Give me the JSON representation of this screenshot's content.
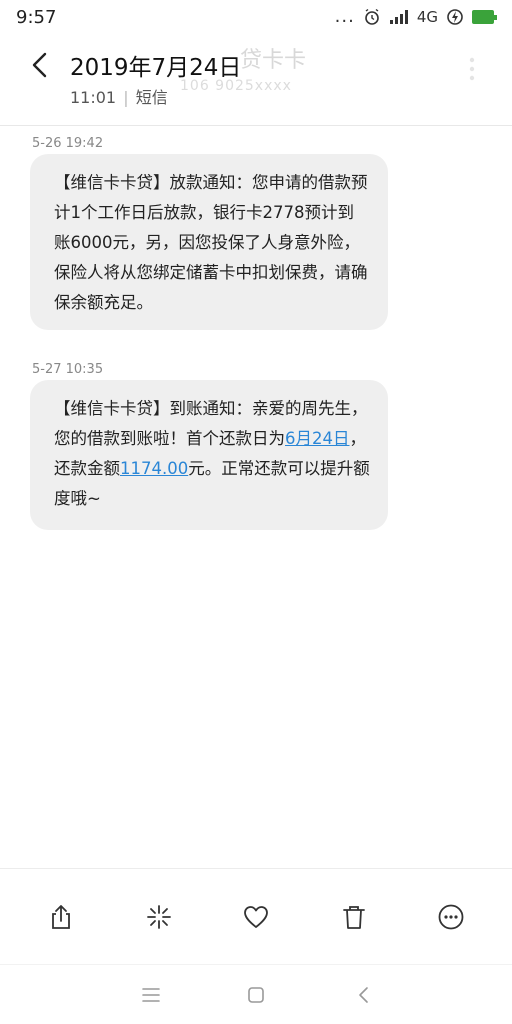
{
  "status_bar": {
    "time": "9:57",
    "dots": "...",
    "network": "4G"
  },
  "header": {
    "title": "2019年7月24日",
    "time": "11:01",
    "separator": "|",
    "type": "短信",
    "ghost_name": "贷卡卡",
    "ghost_number": "106 9025xxxx"
  },
  "messages": [
    {
      "timestamp": "5-26 19:42",
      "text": "【维信卡卡贷】放款通知：您申请的借款预计1个工作日后放款，银行卡2778预计到账6000元，另，因您投保了人身意外险，保险人将从您绑定储蓄卡中扣划保费，请确保余额充足。"
    },
    {
      "timestamp": "5-27 10:35",
      "text_part1": "【维信卡卡贷】到账通知：亲爱的周先生，您的借款到账啦！首个还款日为",
      "link_date": "6月24日",
      "text_part2": "，还款金额",
      "link_amount": "1174.00",
      "text_part3": "元。正常还款可以提升额度哦~"
    }
  ],
  "toolbar": {
    "icons": [
      "share-icon",
      "sparkle-icon",
      "heart-icon",
      "trash-icon",
      "more-circle-icon"
    ]
  },
  "colors": {
    "link": "#2a86d6",
    "bubble": "#efefef",
    "battery": "#3aa33a"
  }
}
